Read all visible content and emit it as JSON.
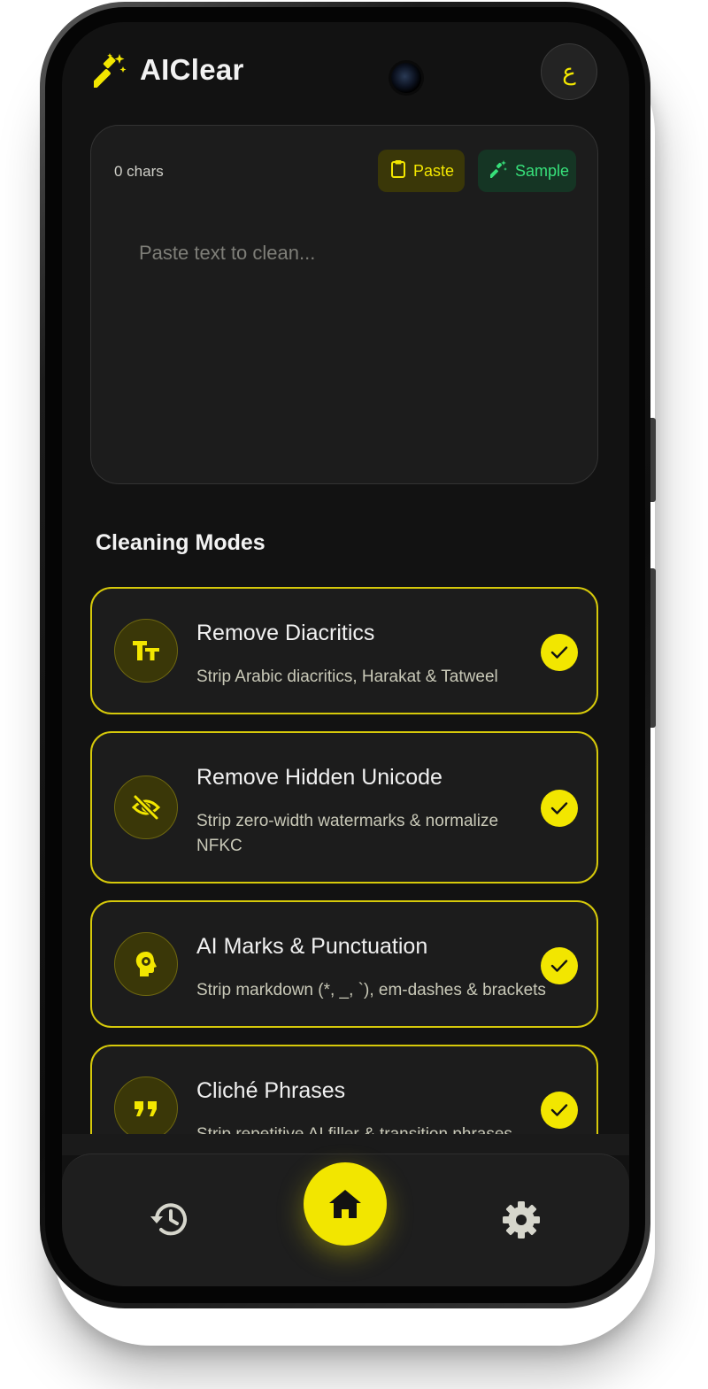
{
  "app": {
    "name": "AIClear",
    "lang_toggle": "ع"
  },
  "editor": {
    "char_count": "0 chars",
    "paste_label": "Paste",
    "sample_label": "Sample",
    "placeholder": "Paste text to clean...",
    "value": ""
  },
  "modes": {
    "section_title": "Cleaning Modes",
    "items": [
      {
        "title": "Remove Diacritics",
        "description": "Strip Arabic diacritics, Harakat & Tatweel",
        "icon": "text-size-icon",
        "enabled": true
      },
      {
        "title": "Remove Hidden Unicode",
        "description": "Strip zero-width watermarks & normalize NFKC",
        "icon": "eye-off-icon",
        "enabled": true
      },
      {
        "title": "AI Marks & Punctuation",
        "description": "Strip markdown (*, _, `), em-dashes & brackets",
        "icon": "brain-gear-icon",
        "enabled": true
      },
      {
        "title": "Cliché Phrases",
        "description": "Strip repetitive AI filler & transition phrases",
        "icon": "quote-icon",
        "enabled": true
      }
    ]
  },
  "nav": {
    "items": [
      "history-icon",
      "home-icon",
      "settings-icon"
    ],
    "active": "home-icon"
  },
  "colors": {
    "accent": "#f2e600",
    "background": "#121212",
    "card": "#1c1c1c",
    "sample_green": "#37e07a"
  }
}
